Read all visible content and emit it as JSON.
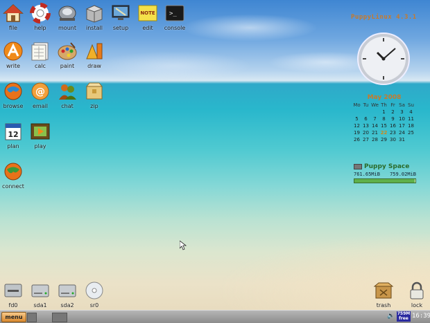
{
  "desktop": {
    "icons": [
      {
        "label": "file"
      },
      {
        "label": "help"
      },
      {
        "label": "mount"
      },
      {
        "label": "install"
      },
      {
        "label": "setup"
      },
      {
        "label": "edit"
      },
      {
        "label": "console"
      },
      {
        "label": "write"
      },
      {
        "label": "calc"
      },
      {
        "label": "paint"
      },
      {
        "label": "draw"
      },
      {
        "label": "browse"
      },
      {
        "label": "email"
      },
      {
        "label": "chat"
      },
      {
        "label": "zip"
      },
      {
        "label": "plan"
      },
      {
        "label": "play"
      },
      {
        "label": "connect"
      }
    ],
    "drives": [
      {
        "label": "fd0"
      },
      {
        "label": "sda1"
      },
      {
        "label": "sda2"
      },
      {
        "label": "sr0"
      }
    ],
    "trash": "trash",
    "lock": "lock"
  },
  "icon_glyphs": {
    "edit_note": "NOTE",
    "console_prompt": ">_",
    "plan_day": "12",
    "email_at": "@"
  },
  "brand": {
    "text": "PuppyLinux 4.3.1"
  },
  "calendar": {
    "title": "May 2008",
    "headers": [
      "Mo",
      "Tu",
      "We",
      "Th",
      "Fr",
      "Sa",
      "Su"
    ],
    "rows": [
      [
        "",
        "",
        "",
        "1",
        "2",
        "3",
        "4"
      ],
      [
        "5",
        "6",
        "7",
        "8",
        "9",
        "10",
        "11"
      ],
      [
        "12",
        "13",
        "14",
        "15",
        "16",
        "17",
        "18"
      ],
      [
        "19",
        "20",
        "21",
        "22",
        "23",
        "24",
        "25"
      ],
      [
        "26",
        "27",
        "28",
        "29",
        "30",
        "31",
        ""
      ]
    ],
    "today": "22"
  },
  "space": {
    "title": "Puppy Space",
    "free": "761.65MiB",
    "total": "759.02MiB",
    "fill_percent": 99
  },
  "taskbar": {
    "menu": "menu",
    "free_badge": "759M free",
    "time": "16:39"
  },
  "colors": {
    "accent": "#c87a2a",
    "space_green": "#2a6b2a"
  }
}
